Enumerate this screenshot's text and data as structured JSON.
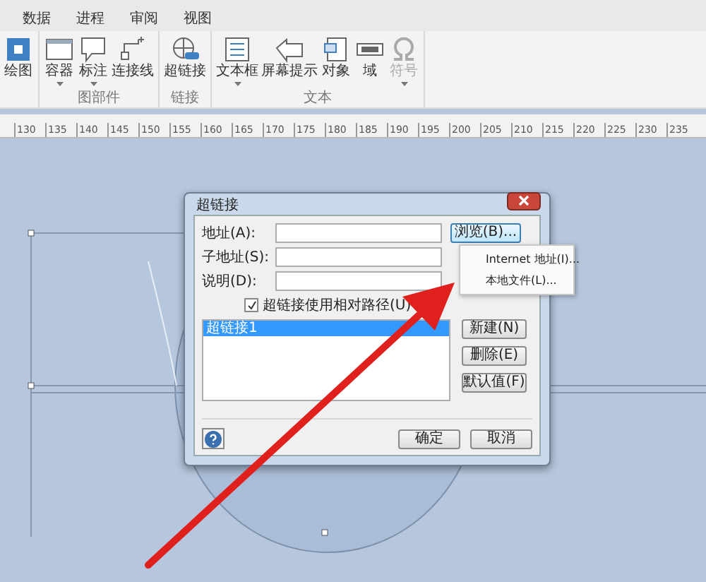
{
  "menu_tabs": [
    {
      "label": "数据",
      "selected": false
    },
    {
      "label": "进程",
      "selected": false
    },
    {
      "label": "审阅",
      "selected": false
    },
    {
      "label": "视图",
      "selected": false
    }
  ],
  "ribbon_groups": [
    {
      "items": [
        {
          "label": "绘图",
          "dropdown": false,
          "disabled": false
        }
      ]
    },
    {
      "label": "图部件",
      "items": [
        {
          "label": "容器",
          "dropdown": true,
          "disabled": false
        },
        {
          "label": "标注",
          "dropdown": true,
          "disabled": false
        },
        {
          "label": "连接线",
          "dropdown": false,
          "disabled": false
        }
      ]
    },
    {
      "label": "链接",
      "items": [
        {
          "label": "超链接",
          "dropdown": false,
          "disabled": false
        }
      ]
    },
    {
      "label": "文本",
      "items": [
        {
          "label": "文本框",
          "dropdown": true,
          "disabled": false
        },
        {
          "label": "屏幕提示",
          "dropdown": false,
          "disabled": false
        },
        {
          "label": "对象",
          "dropdown": false,
          "disabled": false
        },
        {
          "label": "域",
          "dropdown": false,
          "disabled": false
        },
        {
          "label": "符号",
          "dropdown": true,
          "disabled": true
        }
      ]
    }
  ],
  "ruler": [
    "130",
    "135",
    "140",
    "145",
    "150",
    "155",
    "160",
    "165",
    "170",
    "175",
    "180",
    "185",
    "190",
    "195",
    "200",
    "205",
    "210",
    "215",
    "220",
    "225",
    "230",
    "235"
  ],
  "dialog": {
    "title": "超链接",
    "fields": [
      {
        "label": "地址(A):"
      },
      {
        "label": "子地址(S):"
      },
      {
        "label": "说明(D):"
      }
    ],
    "browse_button": "浏览(B)...",
    "checkbox": {
      "label": "超链接使用相对路径(U)",
      "checked": true
    },
    "list": [
      {
        "label": "超链接1",
        "selected": true
      }
    ],
    "side_buttons": [
      "新建(N)",
      "删除(E)",
      "默认值(F)"
    ],
    "ok": "确定",
    "cancel": "取消"
  },
  "browse_menu": [
    "Internet 地址(I)...",
    "本地文件(L)..."
  ]
}
